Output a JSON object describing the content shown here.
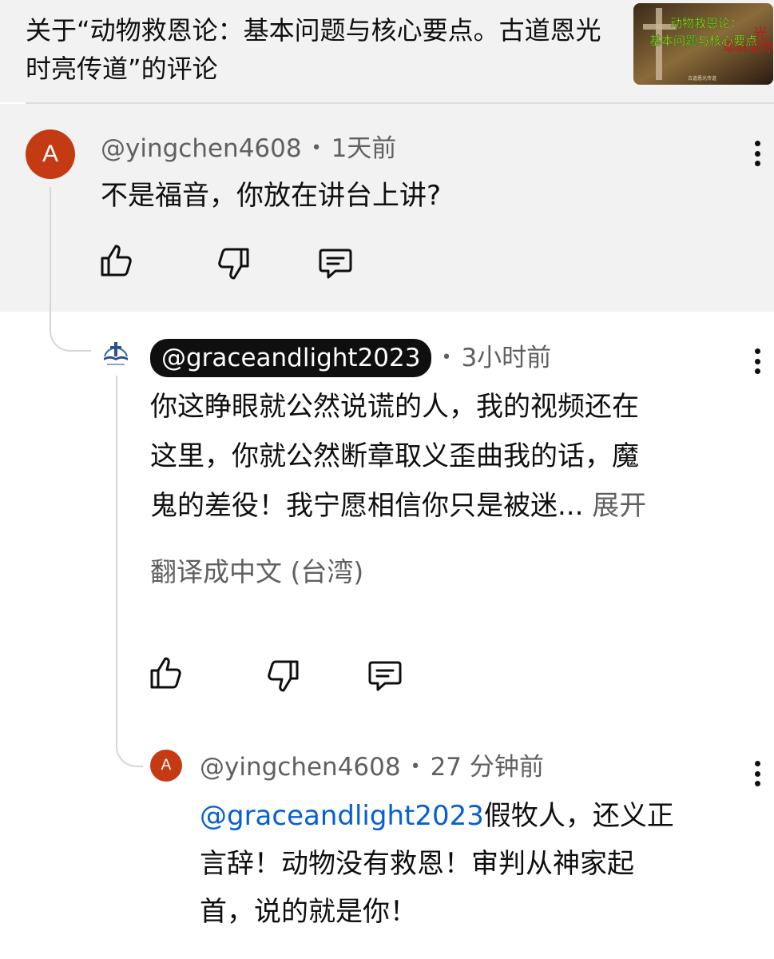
{
  "header": {
    "title": "关于“动物救恩论：基本问题与核心要点。古道恩光时亮传道”的评论",
    "thumbnail": {
      "line1": "动物救恩论：",
      "line2": "基本问题与核心要点",
      "side_text": "光",
      "side_text2": "耶稣爱你",
      "caption": "古道恩光传道"
    }
  },
  "comments": [
    {
      "author": "@yingchen4608",
      "avatar_letter": "A",
      "time": "1天前",
      "text": "不是福音，你放在讲台上讲?",
      "highlighted": true
    },
    {
      "author": "@graceandlight2023",
      "avatar_icon": "church-cross-logo",
      "time": "3小时前",
      "text_lines": [
        "你这睁眼就公然说谎的人，我的视频还在",
        "这里，你就公然断章取义歪曲我的话，魔",
        "鬼的差役！我宁愿相信你只是被迷..."
      ],
      "expand_label": "展开",
      "translate_label": "翻译成中文 (台湾)"
    },
    {
      "author": "@yingchen4608",
      "avatar_letter": "A",
      "time": "27 分钟前",
      "mention": "@graceandlight2023",
      "text_first": "假牧人，还义正",
      "text_lines": [
        "言辞！动物没有救恩！审判从神家起",
        "首，说的就是你！"
      ]
    }
  ],
  "icons": {
    "like": "thumbs-up-icon",
    "dislike": "thumbs-down-icon",
    "reply": "comment-reply-icon",
    "more": "more-vertical-icon"
  },
  "colors": {
    "avatar_bg": "#c43a12",
    "highlight_bg": "#f2f2f2",
    "link": "#065fd4",
    "meta": "#606060"
  }
}
